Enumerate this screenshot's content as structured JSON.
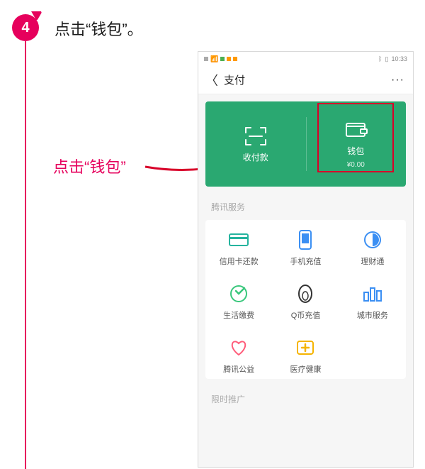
{
  "step": {
    "number": "4",
    "title": "点击“钱包”。"
  },
  "callout": "点击“钱包”",
  "statusbar": {
    "time": "10:33"
  },
  "navbar": {
    "title": "支付",
    "more": "···"
  },
  "green_panel": {
    "left": {
      "label": "收付款"
    },
    "right": {
      "label": "钱包",
      "amount": "¥0.00"
    }
  },
  "section_label_services": "腾讯服务",
  "services": [
    {
      "label": "信用卡还款"
    },
    {
      "label": "手机充值"
    },
    {
      "label": "理财通"
    },
    {
      "label": "生活缴费"
    },
    {
      "label": "Q币充值"
    },
    {
      "label": "城市服务"
    },
    {
      "label": "腾讯公益"
    },
    {
      "label": "医疗健康"
    }
  ],
  "section_label_promo": "限时推广"
}
